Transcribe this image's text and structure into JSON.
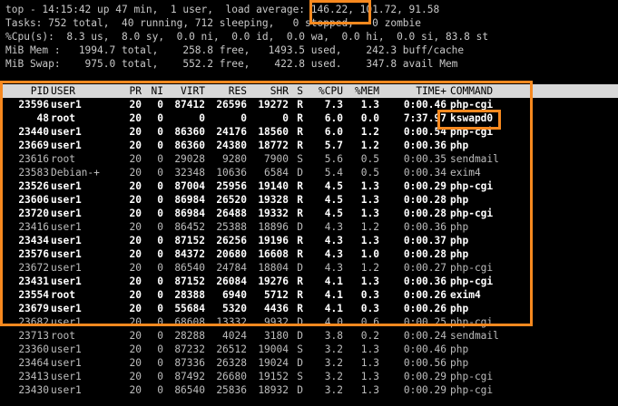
{
  "summary": {
    "top_line_a": "top - 14:15:42 up 47 min,  1 user,  load average: ",
    "load1": "146.22,",
    "load_rest": " 101.72, 91.58",
    "tasks_line": "Tasks: 752 total,  40 running, 712 sleeping,   0 stopped,   0 zombie",
    "cpu_line": "%Cpu(s):  8.3 us,  8.0 sy,  0.0 ni,  0.0 id,  0.0 wa,  0.0 hi,  0.0 si, 83.8 st",
    "mem_line": "MiB Mem :   1994.7 total,    258.8 free,   1493.5 used,    242.3 buff/cache",
    "swap_line": "MiB Swap:    975.0 total,    552.2 free,    422.8 used.    347.8 avail Mem"
  },
  "columns": [
    "PID",
    "USER",
    "PR",
    "NI",
    "VIRT",
    "RES",
    "SHR",
    "S",
    "%CPU",
    "%MEM",
    "TIME+",
    "COMMAND"
  ],
  "processes": [
    {
      "pid": "23596",
      "user": "user1",
      "pr": "20",
      "ni": "0",
      "virt": "87412",
      "res": "26596",
      "shr": "19272",
      "s": "R",
      "cpu": "7.3",
      "mem": "1.3",
      "time": "0:00.46",
      "cmd": "php-cgi",
      "bold": true
    },
    {
      "pid": "48",
      "user": "root",
      "pr": "20",
      "ni": "0",
      "virt": "0",
      "res": "0",
      "shr": "0",
      "s": "R",
      "cpu": "6.0",
      "mem": "0.0",
      "time": "7:37.97",
      "cmd": "kswapd0",
      "bold": true
    },
    {
      "pid": "23440",
      "user": "user1",
      "pr": "20",
      "ni": "0",
      "virt": "86360",
      "res": "24176",
      "shr": "18560",
      "s": "R",
      "cpu": "6.0",
      "mem": "1.2",
      "time": "0:00.54",
      "cmd": "php-cgi",
      "bold": true
    },
    {
      "pid": "23669",
      "user": "user1",
      "pr": "20",
      "ni": "0",
      "virt": "86360",
      "res": "24380",
      "shr": "18772",
      "s": "R",
      "cpu": "5.7",
      "mem": "1.2",
      "time": "0:00.36",
      "cmd": "php",
      "bold": true
    },
    {
      "pid": "23616",
      "user": "root",
      "pr": "20",
      "ni": "0",
      "virt": "29028",
      "res": "9280",
      "shr": "7900",
      "s": "S",
      "cpu": "5.6",
      "mem": "0.5",
      "time": "0:00.35",
      "cmd": "sendmail",
      "bold": false
    },
    {
      "pid": "23583",
      "user": "Debian-+",
      "pr": "20",
      "ni": "0",
      "virt": "32348",
      "res": "10636",
      "shr": "6584",
      "s": "D",
      "cpu": "5.4",
      "mem": "0.5",
      "time": "0:00.34",
      "cmd": "exim4",
      "bold": false
    },
    {
      "pid": "23526",
      "user": "user1",
      "pr": "20",
      "ni": "0",
      "virt": "87004",
      "res": "25956",
      "shr": "19140",
      "s": "R",
      "cpu": "4.5",
      "mem": "1.3",
      "time": "0:00.29",
      "cmd": "php-cgi",
      "bold": true
    },
    {
      "pid": "23606",
      "user": "user1",
      "pr": "20",
      "ni": "0",
      "virt": "86984",
      "res": "26520",
      "shr": "19328",
      "s": "R",
      "cpu": "4.5",
      "mem": "1.3",
      "time": "0:00.28",
      "cmd": "php",
      "bold": true
    },
    {
      "pid": "23720",
      "user": "user1",
      "pr": "20",
      "ni": "0",
      "virt": "86984",
      "res": "26488",
      "shr": "19332",
      "s": "R",
      "cpu": "4.5",
      "mem": "1.3",
      "time": "0:00.28",
      "cmd": "php-cgi",
      "bold": true
    },
    {
      "pid": "23416",
      "user": "user1",
      "pr": "20",
      "ni": "0",
      "virt": "86452",
      "res": "25388",
      "shr": "18896",
      "s": "D",
      "cpu": "4.3",
      "mem": "1.2",
      "time": "0:00.36",
      "cmd": "php",
      "bold": false
    },
    {
      "pid": "23434",
      "user": "user1",
      "pr": "20",
      "ni": "0",
      "virt": "87152",
      "res": "26256",
      "shr": "19196",
      "s": "R",
      "cpu": "4.3",
      "mem": "1.3",
      "time": "0:00.37",
      "cmd": "php",
      "bold": true
    },
    {
      "pid": "23576",
      "user": "user1",
      "pr": "20",
      "ni": "0",
      "virt": "84372",
      "res": "20680",
      "shr": "16608",
      "s": "R",
      "cpu": "4.3",
      "mem": "1.0",
      "time": "0:00.28",
      "cmd": "php",
      "bold": true
    },
    {
      "pid": "23672",
      "user": "user1",
      "pr": "20",
      "ni": "0",
      "virt": "86540",
      "res": "24784",
      "shr": "18804",
      "s": "D",
      "cpu": "4.3",
      "mem": "1.2",
      "time": "0:00.27",
      "cmd": "php-cgi",
      "bold": false
    },
    {
      "pid": "23431",
      "user": "user1",
      "pr": "20",
      "ni": "0",
      "virt": "87152",
      "res": "26084",
      "shr": "19276",
      "s": "R",
      "cpu": "4.1",
      "mem": "1.3",
      "time": "0:00.36",
      "cmd": "php-cgi",
      "bold": true
    },
    {
      "pid": "23554",
      "user": "root",
      "pr": "20",
      "ni": "0",
      "virt": "28388",
      "res": "6940",
      "shr": "5712",
      "s": "R",
      "cpu": "4.1",
      "mem": "0.3",
      "time": "0:00.26",
      "cmd": "exim4",
      "bold": true
    },
    {
      "pid": "23679",
      "user": "user1",
      "pr": "20",
      "ni": "0",
      "virt": "55684",
      "res": "5320",
      "shr": "4436",
      "s": "R",
      "cpu": "4.1",
      "mem": "0.3",
      "time": "0:00.26",
      "cmd": "php",
      "bold": true
    },
    {
      "pid": "23682",
      "user": "user1",
      "pr": "20",
      "ni": "0",
      "virt": "68608",
      "res": "13332",
      "shr": "9932",
      "s": "D",
      "cpu": "4.0",
      "mem": "0.6",
      "time": "0:00.25",
      "cmd": "php-cgi",
      "bold": false
    },
    {
      "pid": "23713",
      "user": "root",
      "pr": "20",
      "ni": "0",
      "virt": "28288",
      "res": "4024",
      "shr": "3180",
      "s": "D",
      "cpu": "3.8",
      "mem": "0.2",
      "time": "0:00.24",
      "cmd": "sendmail",
      "bold": false
    },
    {
      "pid": "23360",
      "user": "user1",
      "pr": "20",
      "ni": "0",
      "virt": "87232",
      "res": "26512",
      "shr": "19004",
      "s": "S",
      "cpu": "3.2",
      "mem": "1.3",
      "time": "0:00.46",
      "cmd": "php",
      "bold": false
    },
    {
      "pid": "23464",
      "user": "user1",
      "pr": "20",
      "ni": "0",
      "virt": "87336",
      "res": "26328",
      "shr": "19024",
      "s": "D",
      "cpu": "3.2",
      "mem": "1.3",
      "time": "0:00.56",
      "cmd": "php",
      "bold": false
    },
    {
      "pid": "23413",
      "user": "user1",
      "pr": "20",
      "ni": "0",
      "virt": "87492",
      "res": "26680",
      "shr": "19152",
      "s": "S",
      "cpu": "3.2",
      "mem": "1.3",
      "time": "0:00.29",
      "cmd": "php-cgi",
      "bold": false
    },
    {
      "pid": "23430",
      "user": "user1",
      "pr": "20",
      "ni": "0",
      "virt": "86540",
      "res": "25836",
      "shr": "18932",
      "s": "D",
      "cpu": "3.2",
      "mem": "1.3",
      "time": "0:00.29",
      "cmd": "php-cgi",
      "bold": false
    }
  ],
  "colors": {
    "highlight_box": "#f7891f",
    "background": "#000000",
    "header_bg": "#d8d8d8"
  }
}
